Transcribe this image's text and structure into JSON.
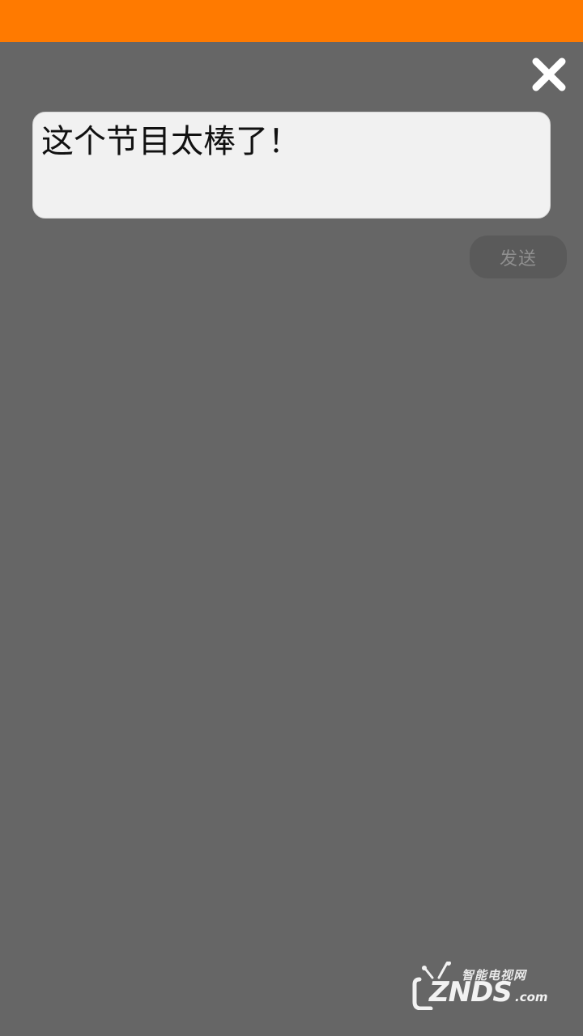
{
  "comment": {
    "text": "这个节目太棒了！"
  },
  "actions": {
    "send_label": "发送",
    "close_icon": "close-icon"
  },
  "watermark": {
    "cn_text": "智能电视网",
    "brand_text": "ZNDS",
    "domain_text": ".com",
    "icon": "tv-icon"
  },
  "colors": {
    "top_bar": "#ff7a00",
    "background": "#666666",
    "input_bg": "#f1f1f1",
    "send_button_bg": "#5a5a5a",
    "send_button_text": "#8f8f8f"
  }
}
